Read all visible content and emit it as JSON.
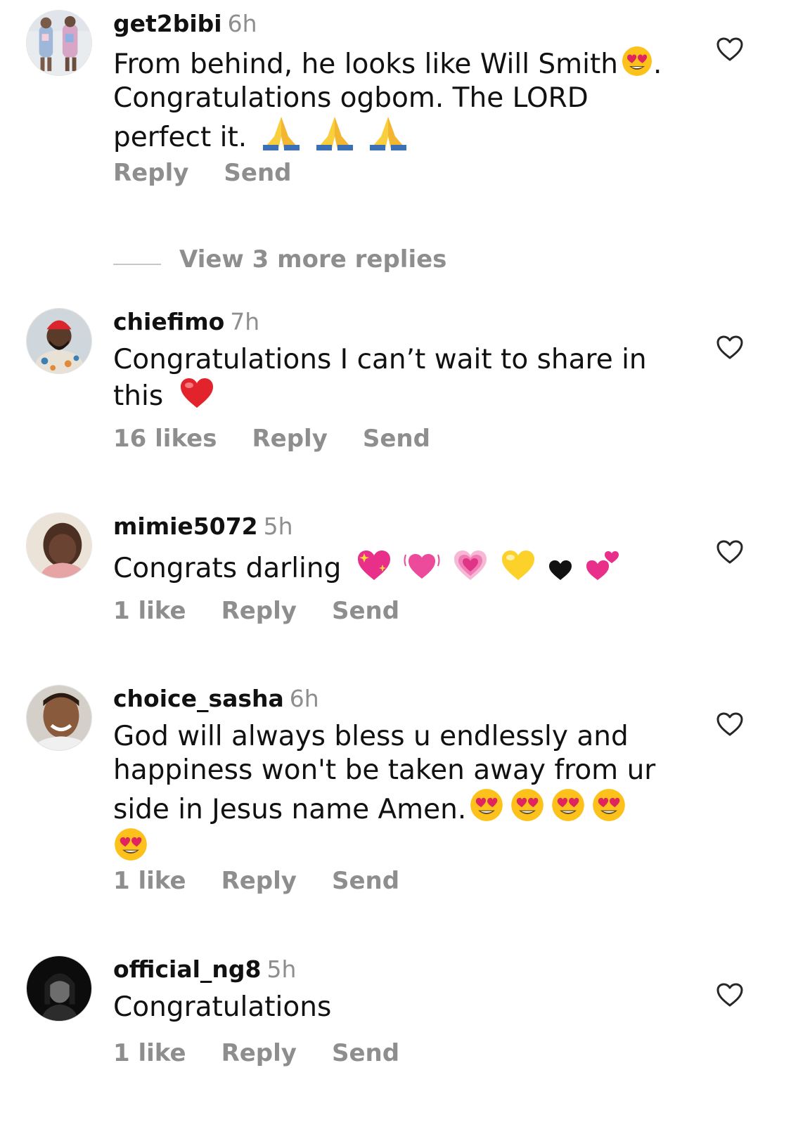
{
  "comments": [
    {
      "username": "get2bibi",
      "time": "6h",
      "text_lines": [
        "From behind, he looks like Will Smith",
        "Congratulations ogbom. The LORD",
        "perfect it."
      ],
      "text_suffix": ".",
      "emojis": [
        "heart-eyes-emoji",
        "folded-hands-emoji",
        "folded-hands-emoji",
        "folded-hands-emoji"
      ],
      "likes": "",
      "reply_label": "Reply",
      "send_label": "Send"
    },
    {
      "username": "chiefimo",
      "time": "7h",
      "text_lines": [
        "Congratulations I can’t wait to share in",
        "this"
      ],
      "emojis": [
        "red-heart-emoji"
      ],
      "likes": "16 likes",
      "reply_label": "Reply",
      "send_label": "Send"
    },
    {
      "username": "mimie5072",
      "time": "5h",
      "text_lines": [
        "Congrats darling"
      ],
      "emojis": [
        "sparkling-heart-emoji",
        "beating-heart-emoji",
        "growing-heart-emoji",
        "yellow-heart-emoji",
        "black-heart-emoji",
        "two-hearts-emoji"
      ],
      "likes": "1 like",
      "reply_label": "Reply",
      "send_label": "Send"
    },
    {
      "username": "choice_sasha",
      "time": "6h",
      "text_lines": [
        "God will always bless u endlessly and",
        "happiness won't be taken away from ur",
        "side in Jesus name Amen."
      ],
      "emojis": [
        "heart-eyes-emoji",
        "heart-eyes-emoji",
        "heart-eyes-emoji",
        "heart-eyes-emoji",
        "heart-eyes-emoji"
      ],
      "likes": "1 like",
      "reply_label": "Reply",
      "send_label": "Send"
    },
    {
      "username": "official_ng8",
      "time": "5h",
      "text_lines": [
        "Congratulations"
      ],
      "emojis": [],
      "likes": "1 like",
      "reply_label": "Reply",
      "send_label": "Send"
    }
  ],
  "view_more_replies": "View 3 more replies",
  "icons": {
    "like": "heart-outline-icon"
  },
  "colors": {
    "text": "#111111",
    "muted": "#8e8e8e",
    "divider": "#c7c7c7"
  }
}
